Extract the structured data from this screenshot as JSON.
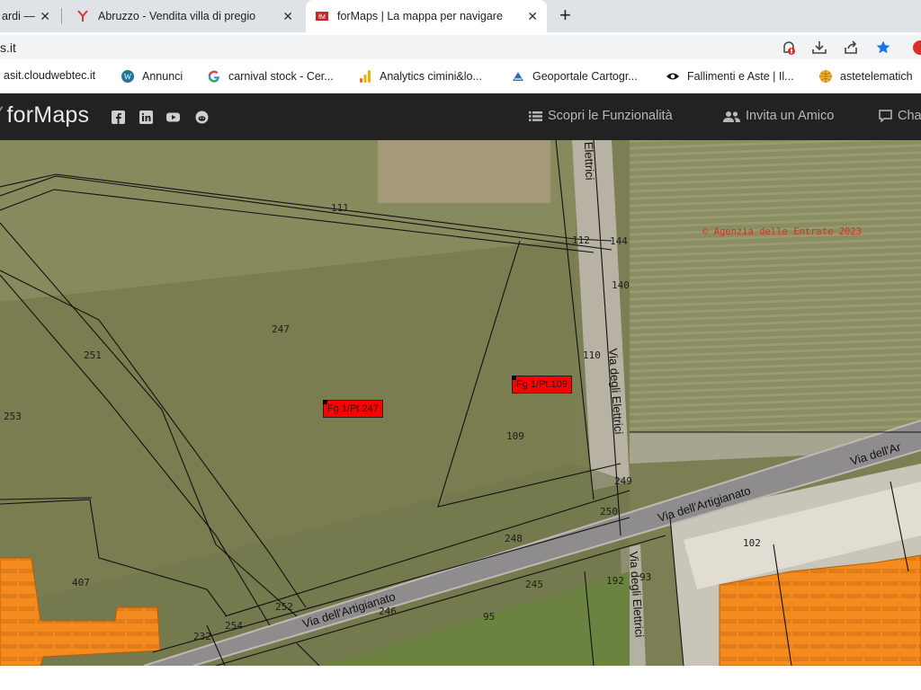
{
  "browser": {
    "tabs": [
      {
        "title": "ardi —",
        "active": false
      },
      {
        "title": "Abruzzo - Vendita villa di pregio",
        "active": false
      },
      {
        "title": "forMaps | La mappa per navigare",
        "active": true
      }
    ],
    "close_glyph": "✕",
    "new_tab_glyph": "+",
    "url": "s.it"
  },
  "bookmarks": [
    {
      "label": "asit.cloudwebtec.it",
      "icon": "page-icon"
    },
    {
      "label": "Annunci",
      "icon": "wordpress-icon"
    },
    {
      "label": "carnival stock - Cer...",
      "icon": "google-icon"
    },
    {
      "label": "Analytics cimini&lo...",
      "icon": "analytics-icon"
    },
    {
      "label": "Geoportale Cartogr...",
      "icon": "geoportale-icon"
    },
    {
      "label": "Fallimenti e Aste | Il...",
      "icon": "eye-icon"
    },
    {
      "label": "astetelematich",
      "icon": "globe-icon"
    }
  ],
  "navbar": {
    "brand": "forMaps",
    "links": [
      {
        "label": "Scopri le Funzionalità",
        "icon": "list-icon"
      },
      {
        "label": "Invita un Amico",
        "icon": "users-icon"
      },
      {
        "label": "Cha",
        "icon": "chat-icon"
      }
    ]
  },
  "map": {
    "copyright": "© Agenzia delle Entrate 2023",
    "parcel_labels": [
      {
        "text": "Fg 1/Pt.247"
      },
      {
        "text": "Fg 1/Pt.109"
      }
    ],
    "parcel_numbers": [
      "111",
      "112",
      "144",
      "140",
      "247",
      "251",
      "253",
      "110",
      "109",
      "249",
      "250",
      "248",
      "102",
      "407",
      "192",
      "93",
      "245",
      "246",
      "95",
      "252",
      "254",
      "232"
    ],
    "road_labels": [
      "Elettrici",
      "Via degli Elettrici",
      "Via dell'Artigianato",
      "Via dell'Ar",
      "Via dell'Artigianato",
      "Via degli Elettrici"
    ]
  },
  "colors": {
    "accent": "#1a73e8",
    "parcel_highlight": "#ff0000",
    "building": "#f58a1f",
    "navbar": "#222222"
  }
}
